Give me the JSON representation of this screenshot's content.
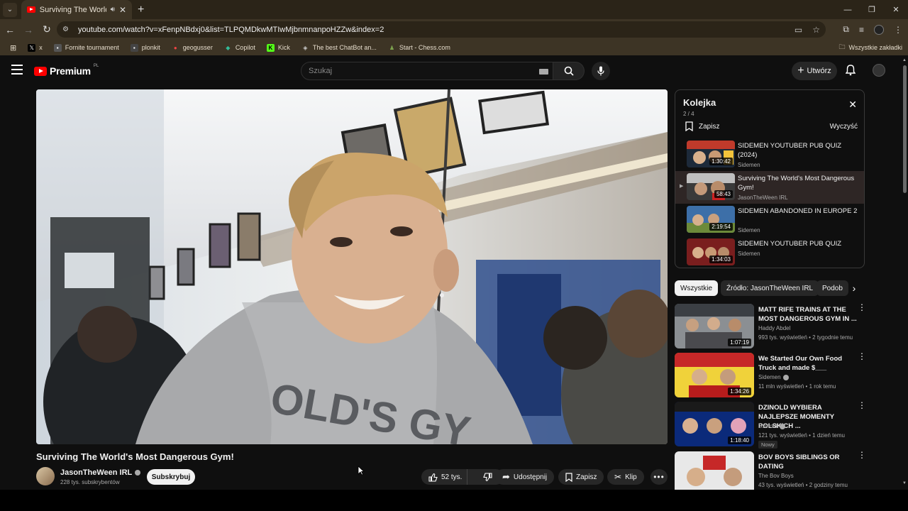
{
  "browser": {
    "tab_title": "Surviving The World's Most",
    "url": "youtube.com/watch?v=xFenpNBdxj0&list=TLPQMDkwMTIwMjbnmnanpoHZZw&index=2",
    "bookmarks": [
      {
        "label": "x",
        "icon": "x-logo-icon",
        "color": "#000000"
      },
      {
        "label": "Fornite tournament",
        "icon": "bookmark-icon",
        "color": "#555555"
      },
      {
        "label": "plonkit",
        "icon": "plonkit-icon",
        "color": "#444444"
      },
      {
        "label": "geogusser",
        "icon": "map-pin-icon",
        "color": "#d33"
      },
      {
        "label": "Copilot",
        "icon": "copilot-icon",
        "color": "#2a7"
      },
      {
        "label": "Kick",
        "icon": "kick-icon",
        "color": "#53fc18"
      },
      {
        "label": "The best ChatBot an...",
        "icon": "chatbot-icon",
        "color": "#ccc"
      },
      {
        "label": "Start - Chess.com",
        "icon": "chess-pawn-icon",
        "color": "#7fa650"
      }
    ],
    "bookmarks_right": "Wszystkie zakładki"
  },
  "header": {
    "logo_text": "Premium",
    "logo_suffix": "PL",
    "search_placeholder": "Szukaj",
    "create_label": "Utwórz"
  },
  "video": {
    "title": "Surviving The World's Most Dangerous Gym!",
    "channel": "JasonTheWeen IRL",
    "subscribers": "228 tys. subskrybentów",
    "subscribe_label": "Subskrybuj",
    "likes": "52 tys.",
    "share_label": "Udostępnij",
    "save_label": "Zapisz",
    "clip_label": "Klip"
  },
  "queue": {
    "title": "Kolejka",
    "count": "2 / 4",
    "save_label": "Zapisz",
    "clear_label": "Wyczyść",
    "items": [
      {
        "title": "SIDEMEN YOUTUBER PUB QUIZ (2024)",
        "channel": "Sidemen",
        "duration": "1:30:42",
        "active": false
      },
      {
        "title": "Surviving The World's Most Dangerous Gym!",
        "channel": "JasonTheWeen IRL",
        "duration": "58:43",
        "active": true
      },
      {
        "title": "SIDEMEN ABANDONED IN EUROPE 2",
        "channel": "Sidemen",
        "duration": "2:19:54",
        "active": false
      },
      {
        "title": "SIDEMEN YOUTUBER PUB QUIZ",
        "channel": "Sidemen",
        "duration": "1:34:03",
        "active": false
      }
    ]
  },
  "chips": [
    "Wszystkie",
    "Źródło: JasonTheWeen IRL",
    "Podob"
  ],
  "recommendations": [
    {
      "title": "MATT RIFE TRAINS AT THE MOST DANGEROUS GYM IN ...",
      "channel": "Haddy Abdel",
      "meta": "993 tys. wyświetleń • 2 tygodnie temu",
      "duration": "1:07:19",
      "verified": false,
      "badge": ""
    },
    {
      "title": "We Started Our Own Food Truck and made $___",
      "channel": "Sidemen",
      "meta": "11 mln wyświetleń • 1 rok temu",
      "duration": "1:34:26",
      "verified": true,
      "badge": ""
    },
    {
      "title": "DZINOLD WYBIERA NAJLEPSZE MOMENTY POLSKICH ...",
      "channel": "Dzinold",
      "meta": "121 tys. wyświetleń • 1 dzień temu",
      "duration": "1:18:40",
      "verified": true,
      "badge": "Nowy"
    },
    {
      "title": "BOV BOYS SIBLINGS OR DATING",
      "channel": "The Bov Boys",
      "meta": "43 tys. wyświetleń • 2 godziny temu",
      "duration": "",
      "verified": false,
      "badge": ""
    }
  ],
  "colors": {
    "brand_red": "#ff0000",
    "background": "#0f0f0f",
    "active_queue": "#2e2625"
  }
}
